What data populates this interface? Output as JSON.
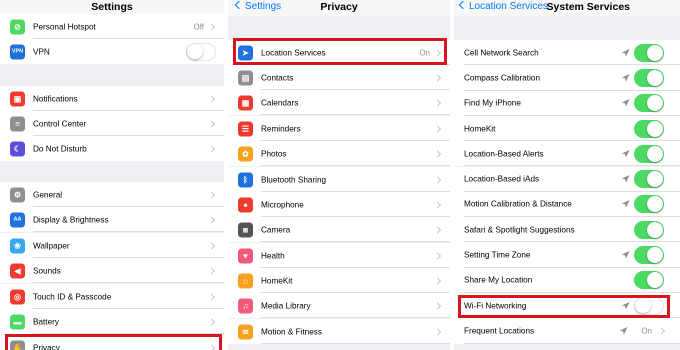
{
  "colors": {
    "ios_blue": "#007aff",
    "switch_green": "#4cd964",
    "highlight_red": "#d9141c"
  },
  "settings": {
    "title": "Settings",
    "rows": [
      {
        "label": "Personal Hotspot",
        "value": "Off",
        "icon": "hotspot-icon",
        "icon_color": "#4cd964",
        "glyph": "⊘"
      },
      {
        "label": "VPN",
        "icon": "vpn-icon",
        "icon_color": "#1f6fd8",
        "glyph": "VPN",
        "switch": "off"
      },
      {
        "label": "Notifications",
        "icon": "notifications-icon",
        "icon_color": "#f2392f",
        "glyph": "▣"
      },
      {
        "label": "Control Center",
        "icon": "control-center-icon",
        "icon_color": "#8e8e93",
        "glyph": "≡"
      },
      {
        "label": "Do Not Disturb",
        "icon": "moon-icon",
        "icon_color": "#5b4fd6",
        "glyph": "☾"
      },
      {
        "label": "General",
        "icon": "gear-icon",
        "icon_color": "#8e8e93",
        "glyph": "⚙"
      },
      {
        "label": "Display & Brightness",
        "icon": "display-icon",
        "icon_color": "#1f72e0",
        "glyph": "AA"
      },
      {
        "label": "Wallpaper",
        "icon": "wallpaper-icon",
        "icon_color": "#35a8f0",
        "glyph": "❀"
      },
      {
        "label": "Sounds",
        "icon": "sounds-icon",
        "icon_color": "#f2392f",
        "glyph": "◀"
      },
      {
        "label": "Touch ID & Passcode",
        "icon": "fingerprint-icon",
        "icon_color": "#f2392f",
        "glyph": "◎"
      },
      {
        "label": "Battery",
        "icon": "battery-icon",
        "icon_color": "#4cd964",
        "glyph": "▬"
      },
      {
        "label": "Privacy",
        "icon": "hand-icon",
        "icon_color": "#8e8e93",
        "glyph": "✋"
      }
    ]
  },
  "privacy": {
    "back_label": "Settings",
    "title": "Privacy",
    "rows": [
      {
        "label": "Location Services",
        "value": "On",
        "icon": "location-arrow-icon",
        "icon_color": "#1f72e0",
        "glyph": "➤"
      },
      {
        "label": "Contacts",
        "icon": "contacts-icon",
        "icon_color": "#8e8e93",
        "glyph": "▤"
      },
      {
        "label": "Calendars",
        "icon": "calendar-icon",
        "icon_color": "#f2392f",
        "glyph": "▦"
      },
      {
        "label": "Reminders",
        "icon": "reminders-icon",
        "icon_color": "#f2392f",
        "glyph": "☰"
      },
      {
        "label": "Photos",
        "icon": "photos-icon",
        "icon_color": "#f7a11e",
        "glyph": "✿"
      },
      {
        "label": "Bluetooth Sharing",
        "icon": "bluetooth-icon",
        "icon_color": "#1f72e0",
        "glyph": "ᛒ"
      },
      {
        "label": "Microphone",
        "icon": "microphone-icon",
        "icon_color": "#f2392f",
        "glyph": "●"
      },
      {
        "label": "Camera",
        "icon": "camera-icon",
        "icon_color": "#555555",
        "glyph": "◙"
      },
      {
        "label": "Health",
        "icon": "health-icon",
        "icon_color": "#f25a7a",
        "glyph": "♥"
      },
      {
        "label": "HomeKit",
        "icon": "homekit-icon",
        "icon_color": "#f7a11e",
        "glyph": "⌂"
      },
      {
        "label": "Media Library",
        "icon": "music-note-icon",
        "icon_color": "#f25a7a",
        "glyph": "♫"
      },
      {
        "label": "Motion & Fitness",
        "icon": "motion-icon",
        "icon_color": "#f7a11e",
        "glyph": "≋"
      }
    ]
  },
  "system_services": {
    "back_label": "Location Services",
    "title": "System Services",
    "rows": [
      {
        "label": "Cell Network Search",
        "arrow": true,
        "switch": "on"
      },
      {
        "label": "Compass Calibration",
        "arrow": true,
        "switch": "on"
      },
      {
        "label": "Find My iPhone",
        "arrow": true,
        "switch": "on"
      },
      {
        "label": "HomeKit",
        "arrow": false,
        "switch": "on"
      },
      {
        "label": "Location-Based Alerts",
        "arrow": true,
        "switch": "on"
      },
      {
        "label": "Location-Based iAds",
        "arrow": true,
        "switch": "on"
      },
      {
        "label": "Motion Calibration & Distance",
        "arrow": true,
        "switch": "on"
      },
      {
        "label": "Safari & Spotlight Suggestions",
        "arrow": false,
        "switch": "on"
      },
      {
        "label": "Setting Time Zone",
        "arrow": true,
        "switch": "on"
      },
      {
        "label": "Share My Location",
        "arrow": false,
        "switch": "on"
      },
      {
        "label": "Wi-Fi Networking",
        "arrow": true,
        "switch": "off"
      },
      {
        "label": "Frequent Locations",
        "arrow": true,
        "value": "On"
      }
    ]
  }
}
